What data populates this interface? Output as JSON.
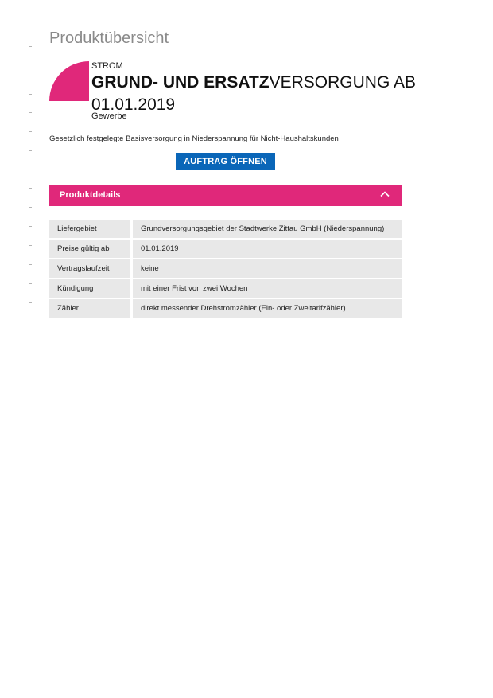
{
  "page": {
    "title": "Produktübersicht"
  },
  "product": {
    "kicker": "STROM",
    "title_strong": "GRUND- UND ERSATZ",
    "title_rest": "VERSORGUNG AB 01.01.2019",
    "segment": "Gewerbe",
    "description": "Gesetzlich festgelegte Basisversorgung in Niederspannung für Nicht-Haushaltskunden",
    "order_button": "AUFTRAG ÖFFNEN"
  },
  "details": {
    "header": "Produktdetails",
    "toggle_icon": "chevron-up-icon",
    "rows": [
      {
        "label": "Liefergebiet",
        "value": "Grundversorgungsgebiet der Stadtwerke Zittau GmbH (Niederspannung)"
      },
      {
        "label": "Preise gültig ab",
        "value": "01.01.2019"
      },
      {
        "label": "Vertragslaufzeit",
        "value": "keine"
      },
      {
        "label": "Kündigung",
        "value": "mit einer Frist von zwei Wochen"
      },
      {
        "label": "Zähler",
        "value": "direkt messender Drehstromzähler (Ein- oder Zweitarifzähler)"
      }
    ]
  },
  "colors": {
    "accent": "#e0287a",
    "button": "#0a66b8",
    "title_grey": "#8a8a8a",
    "table_bg": "#e8e8e8"
  }
}
